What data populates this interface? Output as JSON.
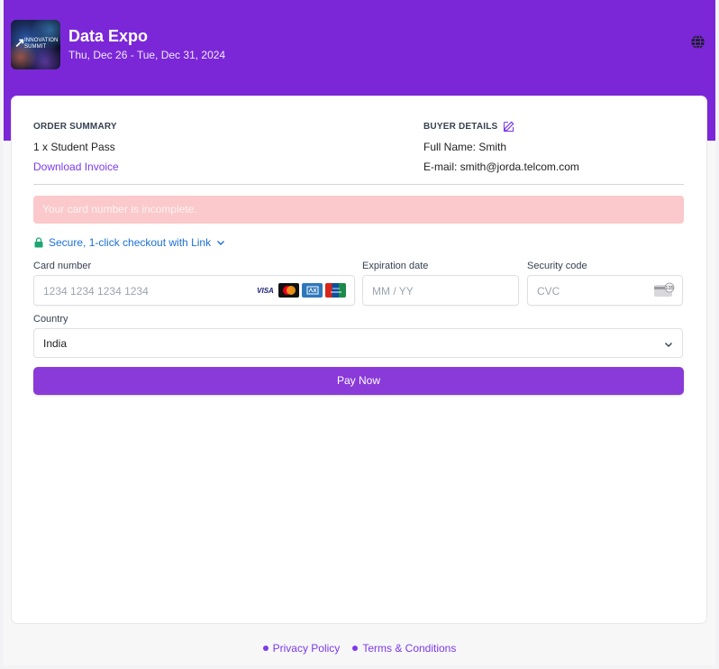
{
  "event": {
    "thumb_text": "INNOVATION SUMMIT",
    "title": "Data Expo",
    "dates": "Thu, Dec 26 - Tue, Dec 31, 2024"
  },
  "order_summary": {
    "heading": "ORDER SUMMARY",
    "item": "1 x Student Pass",
    "invoice_link": "Download Invoice"
  },
  "buyer_details": {
    "heading": "BUYER DETAILS",
    "name_line": "Full Name: Smith",
    "email_line": "E-mail: smith@jorda.telcom.com"
  },
  "error_message": "Your card number is incomplete.",
  "link_checkout": "Secure, 1-click checkout with Link",
  "card_form": {
    "card_number_label": "Card number",
    "card_number_placeholder": "1234 1234 1234 1234",
    "expiry_label": "Expiration date",
    "expiry_placeholder": "MM / YY",
    "cvc_label": "Security code",
    "cvc_placeholder": "CVC",
    "cvc_hint": "135",
    "brands": [
      "VISA",
      "Mastercard",
      "AMEX",
      "UnionPay"
    ]
  },
  "country": {
    "label": "Country",
    "selected": "India"
  },
  "pay_button": "Pay Now",
  "footer": {
    "privacy": "Privacy Policy",
    "terms": "Terms & Conditions"
  },
  "colors": {
    "brand_purple": "#7b27d8",
    "button_purple": "#8a3ad8",
    "link_purple": "#7c3aed",
    "error_bg": "#fbc9cb",
    "link_blue": "#1d6fd6",
    "lock_green": "#1ea672"
  },
  "icons": [
    "globe-icon",
    "edit-icon",
    "lock-icon",
    "chevron-down-icon",
    "card-back-icon"
  ]
}
